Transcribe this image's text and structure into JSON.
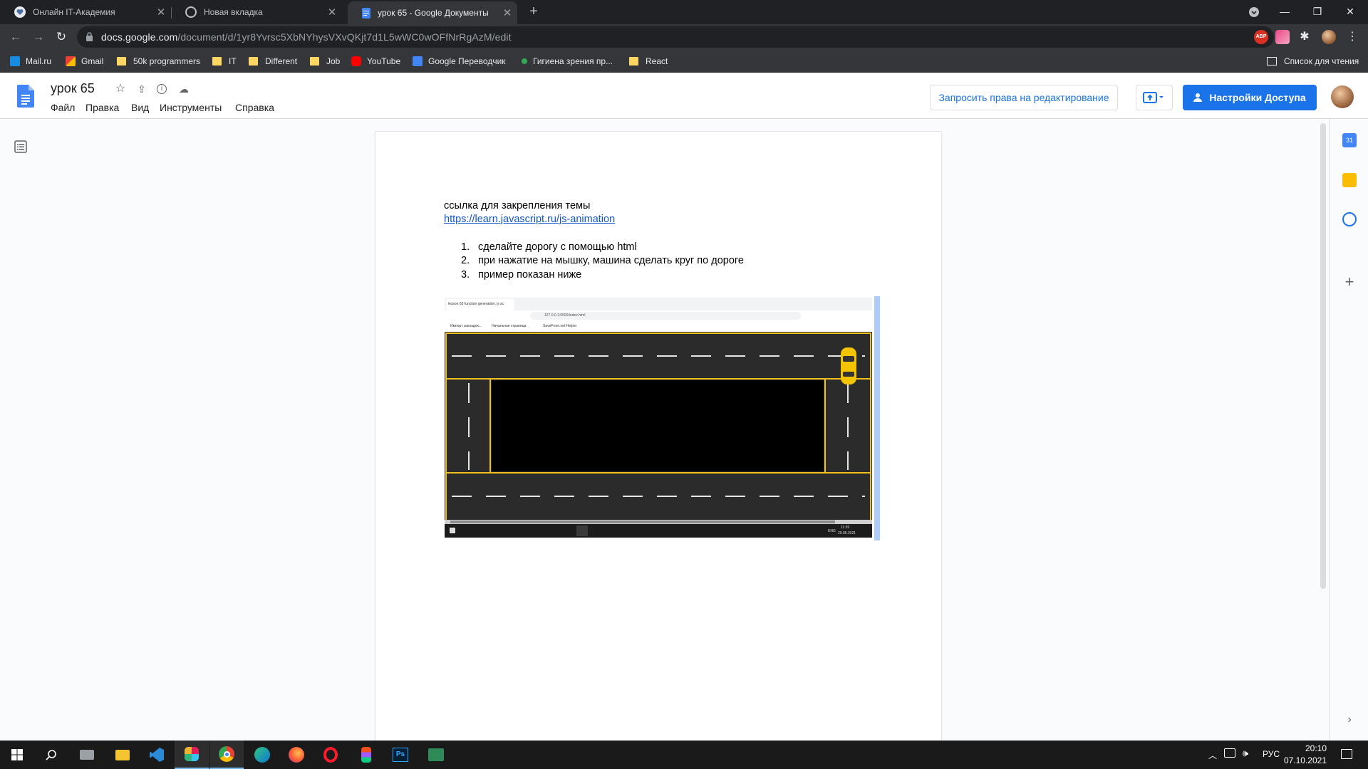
{
  "tabs": [
    {
      "title": "Онлайн IT-Академия",
      "active": false
    },
    {
      "title": "Новая вкладка",
      "active": false
    },
    {
      "title": "урок 65 - Google Документы",
      "active": true
    }
  ],
  "address": {
    "domain": "docs.google.com",
    "path": "/document/d/1yr8Yvrsc5XbNYhysVXvQKjt7d1L5wWC0wOFfNrRgAzM/edit"
  },
  "bookmarks": [
    {
      "label": "Mail.ru",
      "icon": "mailru-icon"
    },
    {
      "label": "Gmail",
      "icon": "gmail-icon"
    },
    {
      "label": "50k programmers",
      "icon": "folder-icon"
    },
    {
      "label": "IT",
      "icon": "folder-icon"
    },
    {
      "label": "Different",
      "icon": "folder-icon"
    },
    {
      "label": "Job",
      "icon": "folder-icon"
    },
    {
      "label": "YouTube",
      "icon": "youtube-icon"
    },
    {
      "label": "Google Переводчик",
      "icon": "translate-icon"
    },
    {
      "label": "Гигиена зрения пр...",
      "icon": "leaf-icon"
    },
    {
      "label": "React",
      "icon": "folder-icon"
    }
  ],
  "reading_list": "Список для чтения",
  "docs": {
    "title": "урок 65",
    "menu": [
      "Файл",
      "Правка",
      "Вид",
      "Инструменты",
      "Справка"
    ],
    "request_edit": "Запросить права на редактирование",
    "share": "Настройки Доступа"
  },
  "document": {
    "intro": "ссылка для закрепления темы",
    "link": "https://learn.javascript.ru/js-animation",
    "list": [
      {
        "num": "1.",
        "text": "сделайте дорогу с помощью html"
      },
      {
        "num": "2.",
        "text": "при нажатие на мышку, машина сделать круг по дороге"
      },
      {
        "num": "3.",
        "text": "пример показан ниже"
      }
    ]
  },
  "embedded_screenshot": {
    "tab_title": "lesson 65 function generation, js sc",
    "url": "127.0.0.1:5500/index.html",
    "bookmarks": [
      "Импорт закладок...",
      "Начальная страница",
      "SaveFrom.net Helper"
    ],
    "tray_lang": "ENG",
    "tray_time": "11:39",
    "tray_date": "29.06.2021"
  },
  "taskbar": {
    "lang": "РУС",
    "time": "20:10",
    "date": "07.10.2021"
  },
  "colors": {
    "docs_blue": "#1a73e8",
    "road": "#2b2b2b",
    "road_line": "#f0c020",
    "car": "#f5c400"
  }
}
